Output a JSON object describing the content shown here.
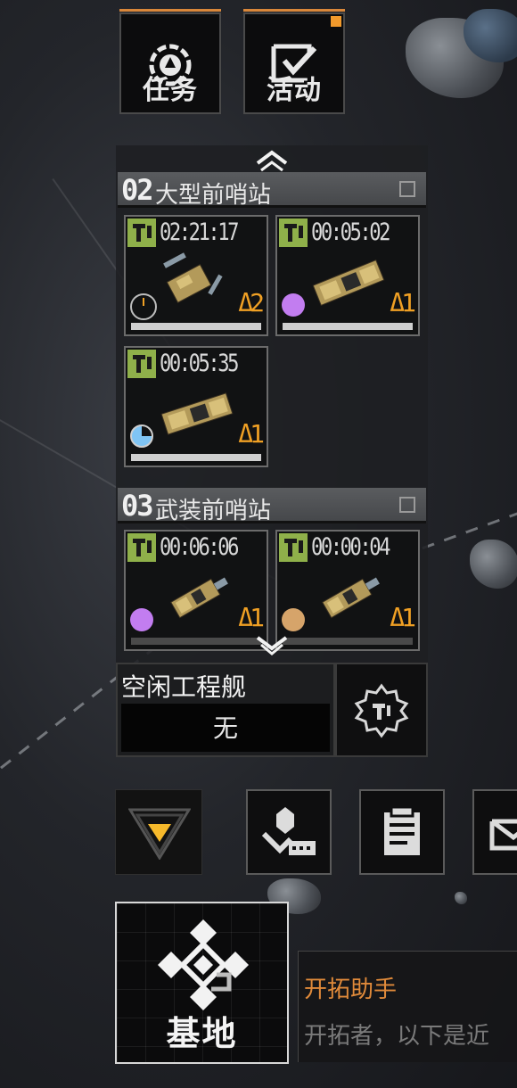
{
  "top_buttons": [
    {
      "label": "任务",
      "icon": "mission-icon"
    },
    {
      "label": "活动",
      "icon": "activity-icon",
      "badge_color": "#f19a2c"
    }
  ],
  "sections": [
    {
      "number": "02",
      "name": "大型前哨站",
      "jobs": [
        {
          "time": "02:21:17",
          "level": "Δ2",
          "status_color": "#f0a024"
        },
        {
          "time": "00:05:02",
          "level": "Δ1",
          "status_color": "#c27df0"
        },
        {
          "time": "00:05:35",
          "level": "Δ1",
          "status_color": "#7fc4f4"
        }
      ]
    },
    {
      "number": "03",
      "name": "武装前哨站",
      "jobs": [
        {
          "time": "00:06:06",
          "level": "Δ1",
          "status_color": "#c27df0"
        },
        {
          "time": "00:00:04",
          "level": "Δ1",
          "status_color": "#d6a46a"
        }
      ]
    }
  ],
  "idle_ships": {
    "title": "空闲工程舰",
    "value": "无"
  },
  "base": {
    "label": "基地"
  },
  "assistant": {
    "title": "开拓助手",
    "message": "开拓者，以下是近"
  },
  "colors": {
    "accent": "#d9873a",
    "wrench": "#8fb04a",
    "level": "#f0a024"
  }
}
